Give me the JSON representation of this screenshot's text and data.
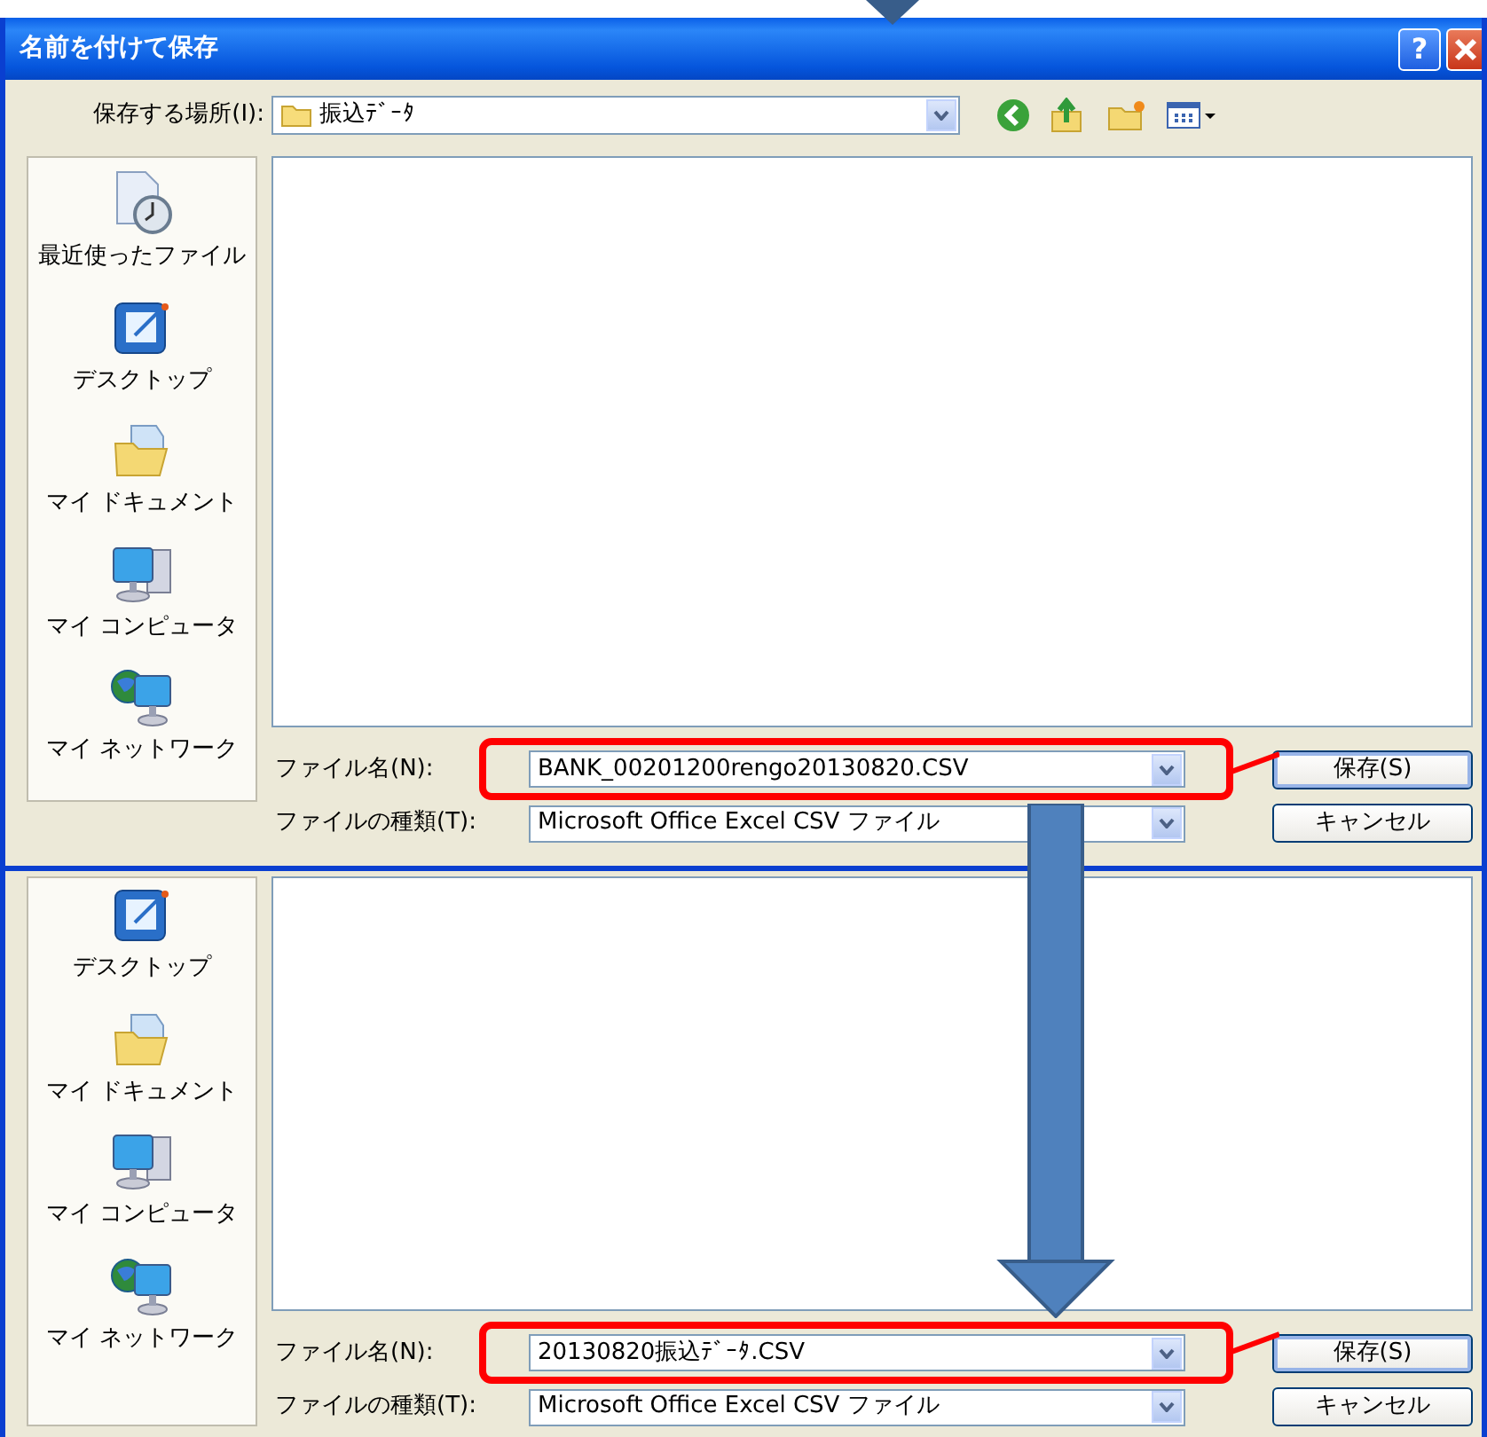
{
  "dialogs": [
    {
      "title": "名前を付けて保存",
      "help_button": "?",
      "location_label": "保存する場所(I):",
      "location": "振込ﾃﾞｰﾀ",
      "places": [
        {
          "kind": "recent",
          "label": "最近使ったファイル"
        },
        {
          "kind": "desktop",
          "label": "デスクトップ"
        },
        {
          "kind": "documents",
          "label": "マイ ドキュメント"
        },
        {
          "kind": "computer",
          "label": "マイ コンピュータ"
        },
        {
          "kind": "network",
          "label": "マイ ネットワーク"
        }
      ],
      "file_name_label": "ファイル名(N):",
      "file_name": "BANK_00201200rengo20130820.CSV",
      "file_name_highlighted": true,
      "file_type_label": "ファイルの種類(T):",
      "file_type": "Microsoft Office Excel CSV ファイル",
      "save_button": "保存(S)",
      "cancel_button": "キャンセル"
    },
    {
      "places": [
        {
          "kind": "desktop",
          "label": "デスクトップ"
        },
        {
          "kind": "documents",
          "label": "マイ ドキュメント"
        },
        {
          "kind": "computer",
          "label": "マイ コンピュータ"
        },
        {
          "kind": "network",
          "label": "マイ ネットワーク"
        }
      ],
      "file_name_label": "ファイル名(N):",
      "file_name": "20130820振込ﾃﾞｰﾀ.CSV",
      "file_name_highlighted": true,
      "file_type_label": "ファイルの種類(T):",
      "file_type": "Microsoft Office Excel CSV ファイル",
      "save_button": "保存(S)",
      "cancel_button": "キャンセル"
    }
  ]
}
